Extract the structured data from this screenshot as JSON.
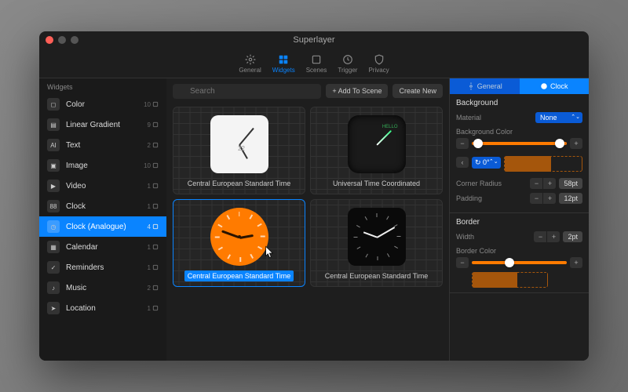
{
  "window": {
    "title": "Superlayer"
  },
  "tabs": [
    {
      "label": "General",
      "icon": "gear"
    },
    {
      "label": "Widgets",
      "icon": "grid",
      "active": true
    },
    {
      "label": "Scenes",
      "icon": "stack"
    },
    {
      "label": "Trigger",
      "icon": "bolt"
    },
    {
      "label": "Privacy",
      "icon": "shield"
    }
  ],
  "sidebar": {
    "header": "Widgets",
    "items": [
      {
        "label": "Color",
        "count": "10",
        "icon": "square"
      },
      {
        "label": "Linear Gradient",
        "count": "9",
        "icon": "gradient"
      },
      {
        "label": "Text",
        "count": "2",
        "icon": "AI"
      },
      {
        "label": "Image",
        "count": "10",
        "icon": "image"
      },
      {
        "label": "Video",
        "count": "1",
        "icon": "video"
      },
      {
        "label": "Clock",
        "count": "1",
        "icon": "digital"
      },
      {
        "label": "Clock (Analogue)",
        "count": "4",
        "icon": "clock",
        "selected": true
      },
      {
        "label": "Calendar",
        "count": "1",
        "icon": "calendar"
      },
      {
        "label": "Reminders",
        "count": "1",
        "icon": "check"
      },
      {
        "label": "Music",
        "count": "2",
        "icon": "music"
      },
      {
        "label": "Location",
        "count": "1",
        "icon": "pin"
      }
    ]
  },
  "toolbar": {
    "search_placeholder": "Search",
    "add_to_scene": "+ Add To Scene",
    "create_new": "Create New"
  },
  "cards": [
    {
      "label": "Central European Standard Time",
      "preview": "white-analog"
    },
    {
      "label": "Universal Time Coordinated",
      "preview": "dark-neon"
    },
    {
      "label": "Central European Standard Time",
      "preview": "orange-analog",
      "selected": true
    },
    {
      "label": "Central European Standard Time",
      "preview": "black-analog"
    }
  ],
  "inspector": {
    "tabs": [
      {
        "label": "General",
        "icon": "gear"
      },
      {
        "label": "Clock",
        "icon": "clock",
        "active": true
      }
    ],
    "background": {
      "title": "Background",
      "material_label": "Material",
      "material_value": "None",
      "bg_color_label": "Background Color",
      "angle_value": "0°",
      "corner_radius_label": "Corner Radius",
      "corner_radius_value": "58pt",
      "padding_label": "Padding",
      "padding_value": "12pt"
    },
    "border": {
      "title": "Border",
      "width_label": "Width",
      "width_value": "2pt",
      "color_label": "Border Color"
    },
    "colors": {
      "accent": "#ff7b00"
    }
  }
}
